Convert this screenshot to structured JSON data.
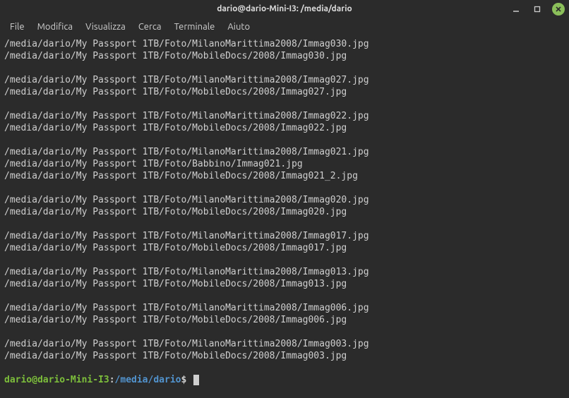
{
  "window": {
    "title": "dario@dario-Mini-I3: /media/dario"
  },
  "menu": {
    "file": "File",
    "edit": "Modifica",
    "view": "Visualizza",
    "search": "Cerca",
    "terminal": "Terminale",
    "help": "Aiuto"
  },
  "output": {
    "groups": [
      [
        "/media/dario/My Passport 1TB/Foto/MilanoMarittima2008/Immag030.jpg",
        "/media/dario/My Passport 1TB/Foto/MobileDocs/2008/Immag030.jpg"
      ],
      [
        "/media/dario/My Passport 1TB/Foto/MilanoMarittima2008/Immag027.jpg",
        "/media/dario/My Passport 1TB/Foto/MobileDocs/2008/Immag027.jpg"
      ],
      [
        "/media/dario/My Passport 1TB/Foto/MilanoMarittima2008/Immag022.jpg",
        "/media/dario/My Passport 1TB/Foto/MobileDocs/2008/Immag022.jpg"
      ],
      [
        "/media/dario/My Passport 1TB/Foto/MilanoMarittima2008/Immag021.jpg",
        "/media/dario/My Passport 1TB/Foto/Babbino/Immag021.jpg",
        "/media/dario/My Passport 1TB/Foto/MobileDocs/2008/Immag021_2.jpg"
      ],
      [
        "/media/dario/My Passport 1TB/Foto/MilanoMarittima2008/Immag020.jpg",
        "/media/dario/My Passport 1TB/Foto/MobileDocs/2008/Immag020.jpg"
      ],
      [
        "/media/dario/My Passport 1TB/Foto/MilanoMarittima2008/Immag017.jpg",
        "/media/dario/My Passport 1TB/Foto/MobileDocs/2008/Immag017.jpg"
      ],
      [
        "/media/dario/My Passport 1TB/Foto/MilanoMarittima2008/Immag013.jpg",
        "/media/dario/My Passport 1TB/Foto/MobileDocs/2008/Immag013.jpg"
      ],
      [
        "/media/dario/My Passport 1TB/Foto/MilanoMarittima2008/Immag006.jpg",
        "/media/dario/My Passport 1TB/Foto/MobileDocs/2008/Immag006.jpg"
      ],
      [
        "/media/dario/My Passport 1TB/Foto/MilanoMarittima2008/Immag003.jpg",
        "/media/dario/My Passport 1TB/Foto/MobileDocs/2008/Immag003.jpg"
      ]
    ]
  },
  "prompt": {
    "user_host": "dario@dario-Mini-I3",
    "colon": ":",
    "path": "/media/dario",
    "symbol": "$",
    "input": ""
  }
}
